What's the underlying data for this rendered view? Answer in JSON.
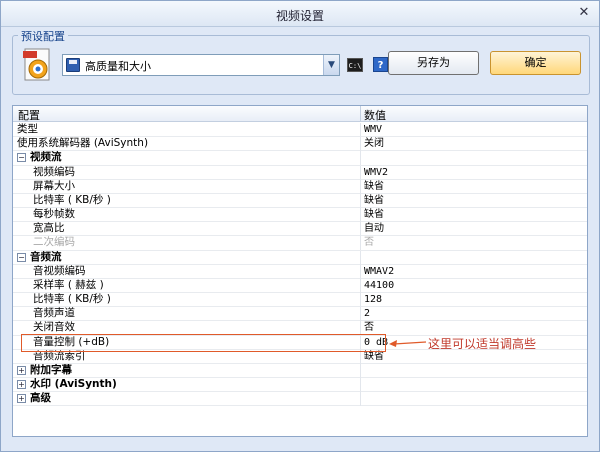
{
  "window": {
    "title": "视频设置"
  },
  "preset": {
    "legend": "预设配置",
    "selected": "高质量和大小",
    "cmd_icon_text": "C:\\",
    "help_text": "?",
    "saveas_label": "另存为",
    "ok_label": "确定"
  },
  "grid": {
    "col_name": "配置",
    "col_value": "数值",
    "rows": [
      {
        "name": "类型",
        "value": "WMV",
        "level": 0,
        "kind": "prop"
      },
      {
        "name": "使用系统解码器 (AviSynth)",
        "value": "关闭",
        "level": 0,
        "kind": "prop"
      },
      {
        "name": "视频流",
        "value": "",
        "level": 0,
        "kind": "cat",
        "expander": "⊟"
      },
      {
        "name": "视频编码",
        "value": "WMV2",
        "level": 1,
        "kind": "prop"
      },
      {
        "name": "屏幕大小",
        "value": "缺省",
        "level": 1,
        "kind": "prop"
      },
      {
        "name": "比特率 ( KB/秒 )",
        "value": "缺省",
        "level": 1,
        "kind": "prop"
      },
      {
        "name": "每秒帧数",
        "value": "缺省",
        "level": 1,
        "kind": "prop"
      },
      {
        "name": "宽高比",
        "value": "自动",
        "level": 1,
        "kind": "prop"
      },
      {
        "name": "二次编码",
        "value": "否",
        "level": 1,
        "kind": "prop",
        "disabled": true
      },
      {
        "name": "音频流",
        "value": "",
        "level": 0,
        "kind": "cat",
        "expander": "⊟"
      },
      {
        "name": "音视频编码",
        "value": "WMAV2",
        "level": 1,
        "kind": "prop"
      },
      {
        "name": "采样率 ( 赫兹 )",
        "value": "44100",
        "level": 1,
        "kind": "prop"
      },
      {
        "name": "比特率 ( KB/秒 )",
        "value": "128",
        "level": 1,
        "kind": "prop"
      },
      {
        "name": "音频声道",
        "value": "2",
        "level": 1,
        "kind": "prop"
      },
      {
        "name": "关闭音效",
        "value": "否",
        "level": 1,
        "kind": "prop"
      },
      {
        "name": "音量控制 (+dB)",
        "value": "0 dB",
        "level": 1,
        "kind": "prop"
      },
      {
        "name": "音频流索引",
        "value": "缺省",
        "level": 1,
        "kind": "prop"
      },
      {
        "name": "附加字幕",
        "value": "",
        "level": 0,
        "kind": "cat",
        "expander": "⊞"
      },
      {
        "name": "水印 (AviSynth)",
        "value": "",
        "level": 0,
        "kind": "cat",
        "expander": "⊞"
      },
      {
        "name": "高级",
        "value": "",
        "level": 0,
        "kind": "cat",
        "expander": "⊞"
      }
    ]
  },
  "annotation": {
    "text": "这里可以适当调高些",
    "color": "#c0392b"
  }
}
